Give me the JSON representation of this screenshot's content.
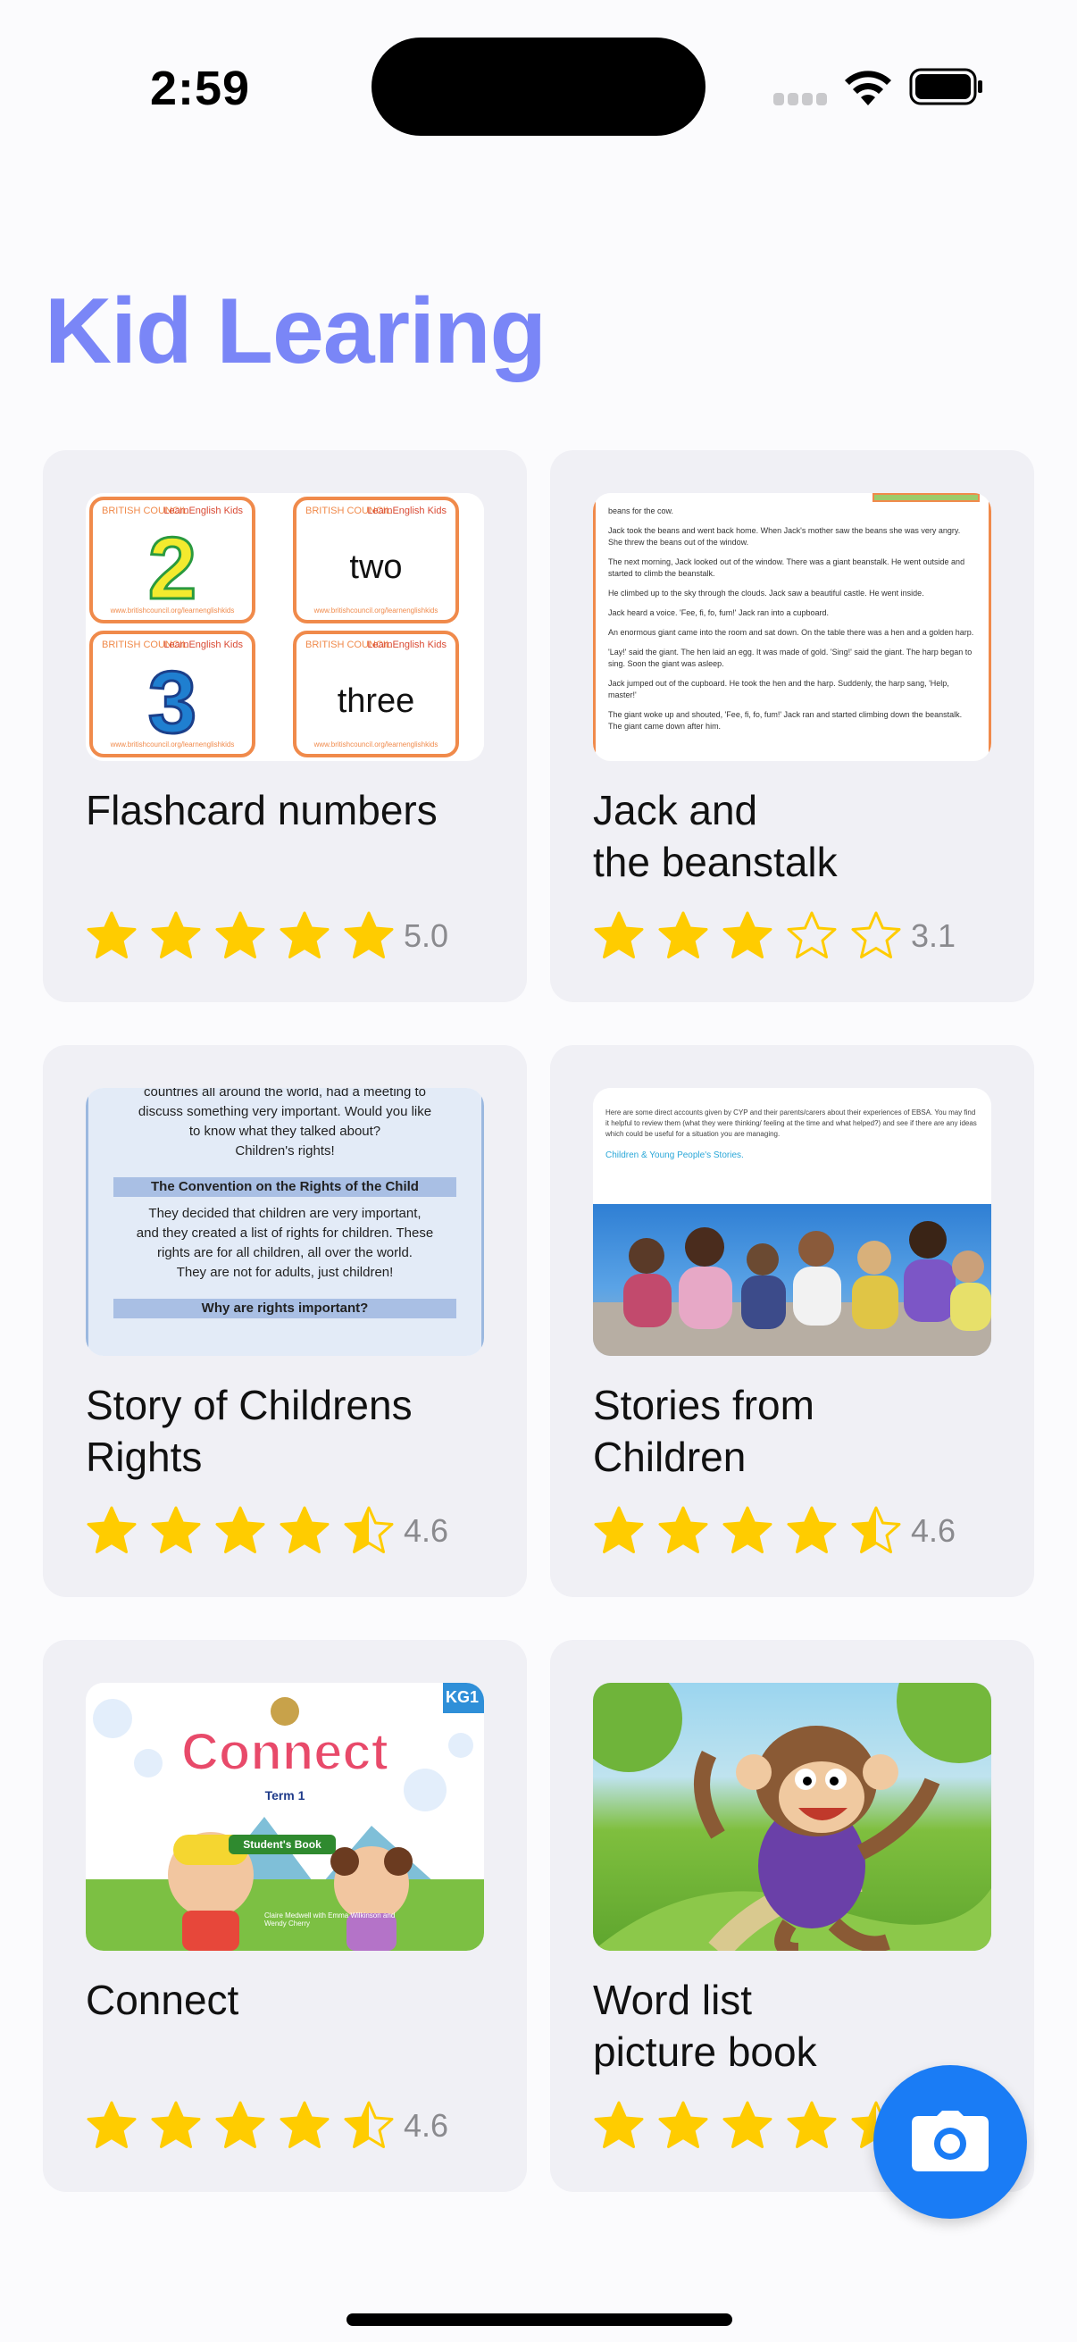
{
  "status_bar": {
    "time": "2:59"
  },
  "app": {
    "title": "Kid Learing"
  },
  "colors": {
    "title": "#7a86f7",
    "card_background": "#f0f0f5",
    "star_fill": "#ffcc00",
    "fab": "#1a7cf5"
  },
  "cards": [
    {
      "title": "Flashcard numbers",
      "rating": 5.0,
      "rating_label": "5.0",
      "thumbnail": {
        "brand": "BRITISH COUNCIL",
        "brand_title": "LearnEnglish Kids",
        "url": "www.britishcouncil.org/learnenglishkids",
        "tiles": [
          "2",
          "two",
          "3",
          "three"
        ]
      }
    },
    {
      "title": "Jack and\nthe beanstalk",
      "rating": 3.1,
      "rating_label": "3.1",
      "thumbnail": {
        "lines": [
          "beans for the cow.",
          "Jack took the beans and went back home. When Jack's mother saw the beans she was very angry. She threw the beans out of the window.",
          "The next morning, Jack looked out of the window. There was a giant beanstalk. He went outside and started to climb the beanstalk.",
          "He climbed up to the sky through the clouds. Jack saw a beautiful castle. He went inside.",
          "Jack heard a voice. 'Fee, fi, fo, fum!' Jack ran into a cupboard.",
          "An enormous giant came into the room and sat down. On the table there was a hen and a golden harp.",
          "'Lay!' said the giant. The hen laid an egg. It was made of gold. 'Sing!' said the giant. The harp began to sing. Soon the giant was asleep.",
          "Jack jumped out of the cupboard. He took the hen and the harp. Suddenly, the harp sang, 'Help, master!'",
          "The giant woke up and shouted, 'Fee, fi, fo, fum!' Jack ran and started climbing down the beanstalk. The giant came down after him."
        ]
      }
    },
    {
      "title": "Story of Childrens\nRights",
      "rating": 4.6,
      "rating_label": "4.6",
      "thumbnail": {
        "lines": [
          "countries all around the world, had a meeting to",
          "discuss something very important. Would you like",
          "to know what they talked about?",
          "Children's rights!"
        ],
        "heading1": "The Convention on the Rights of the Child",
        "para": [
          "They decided that children are very important,",
          "and they created a list of rights for children. These",
          "rights are for all children, all over the world.",
          "They are not for adults, just children!"
        ],
        "heading2": "Why are rights important?"
      }
    },
    {
      "title": "Stories from\nChildren",
      "rating": 4.6,
      "rating_label": "4.6",
      "thumbnail": {
        "text": "Here are some direct accounts given by CYP and their parents/carers about their experiences of EBSA. You may find it helpful to review them (what they were thinking/ feeling at the time and what helped?) and see if there are any ideas which could be useful for a situation you are managing.",
        "link": "Children & Young People's Stories."
      }
    },
    {
      "title": "Connect",
      "rating": 4.6,
      "rating_label": "4.6",
      "thumbnail": {
        "badge": "KG1",
        "book_title": "Connect",
        "term": "Term 1",
        "subtitle": "Student's Book",
        "authors": "Claire Medwell with Emma Wilkinson and Wendy Cherry"
      }
    },
    {
      "title": "Word list\npicture book",
      "rating": 4.6,
      "rating_label": "",
      "thumbnail": {
        "subject": "cartoon monkey"
      }
    }
  ],
  "fab": {
    "icon": "camera-icon"
  }
}
